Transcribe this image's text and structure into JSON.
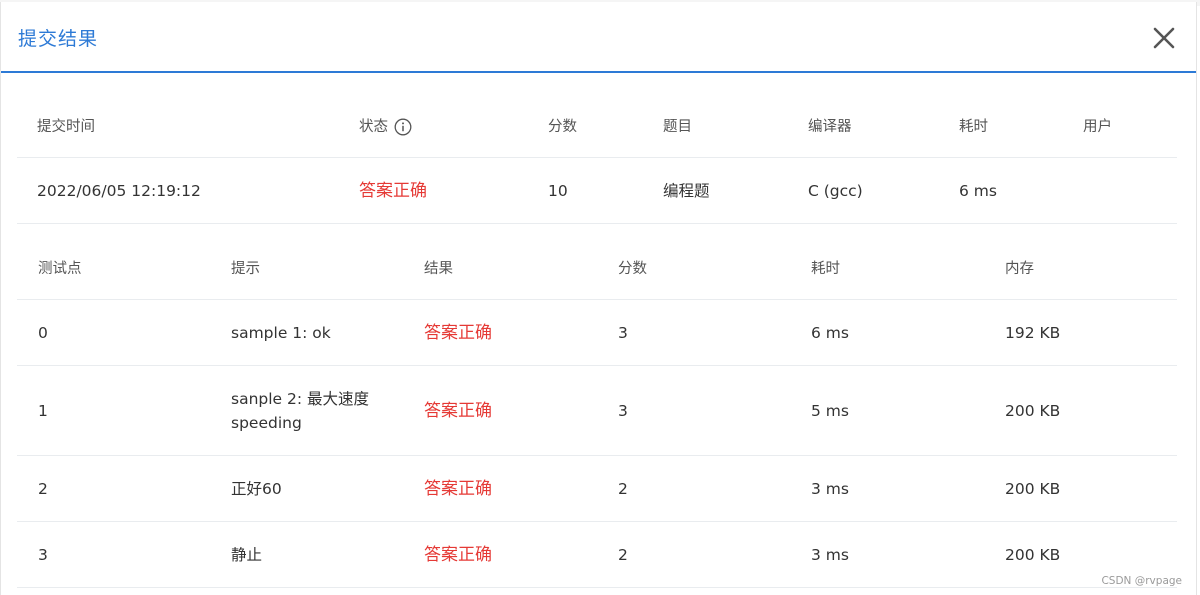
{
  "modal": {
    "title": "提交结果",
    "close_icon": "close-icon"
  },
  "submission": {
    "headers": {
      "time": "提交时间",
      "status": "状态",
      "score": "分数",
      "problem": "题目",
      "compiler": "编译器",
      "time_cost": "耗时",
      "user": "用户"
    },
    "status_info_icon": "info-circle-icon",
    "row": {
      "time": "2022/06/05 12:19:12",
      "status": "答案正确",
      "score": "10",
      "problem": "编程题",
      "compiler": "C (gcc)",
      "time_cost": "6 ms",
      "user": ""
    }
  },
  "testcases": {
    "headers": {
      "point": "测试点",
      "hint": "提示",
      "result": "结果",
      "score": "分数",
      "time_cost": "耗时",
      "memory": "内存"
    },
    "rows": [
      {
        "point": "0",
        "hint": "sample 1: ok",
        "result": "答案正确",
        "score": "3",
        "time_cost": "6 ms",
        "memory": "192 KB"
      },
      {
        "point": "1",
        "hint": "sanple 2: 最大速度 speeding",
        "result": "答案正确",
        "score": "3",
        "time_cost": "5 ms",
        "memory": "200 KB"
      },
      {
        "point": "2",
        "hint": "正好60",
        "result": "答案正确",
        "score": "2",
        "time_cost": "3 ms",
        "memory": "200 KB"
      },
      {
        "point": "3",
        "hint": "静止",
        "result": "答案正确",
        "score": "2",
        "time_cost": "3 ms",
        "memory": "200 KB"
      }
    ]
  },
  "colors": {
    "accent": "#2d7ad6",
    "accepted": "#e53935"
  },
  "watermark": "CSDN @rvpage"
}
